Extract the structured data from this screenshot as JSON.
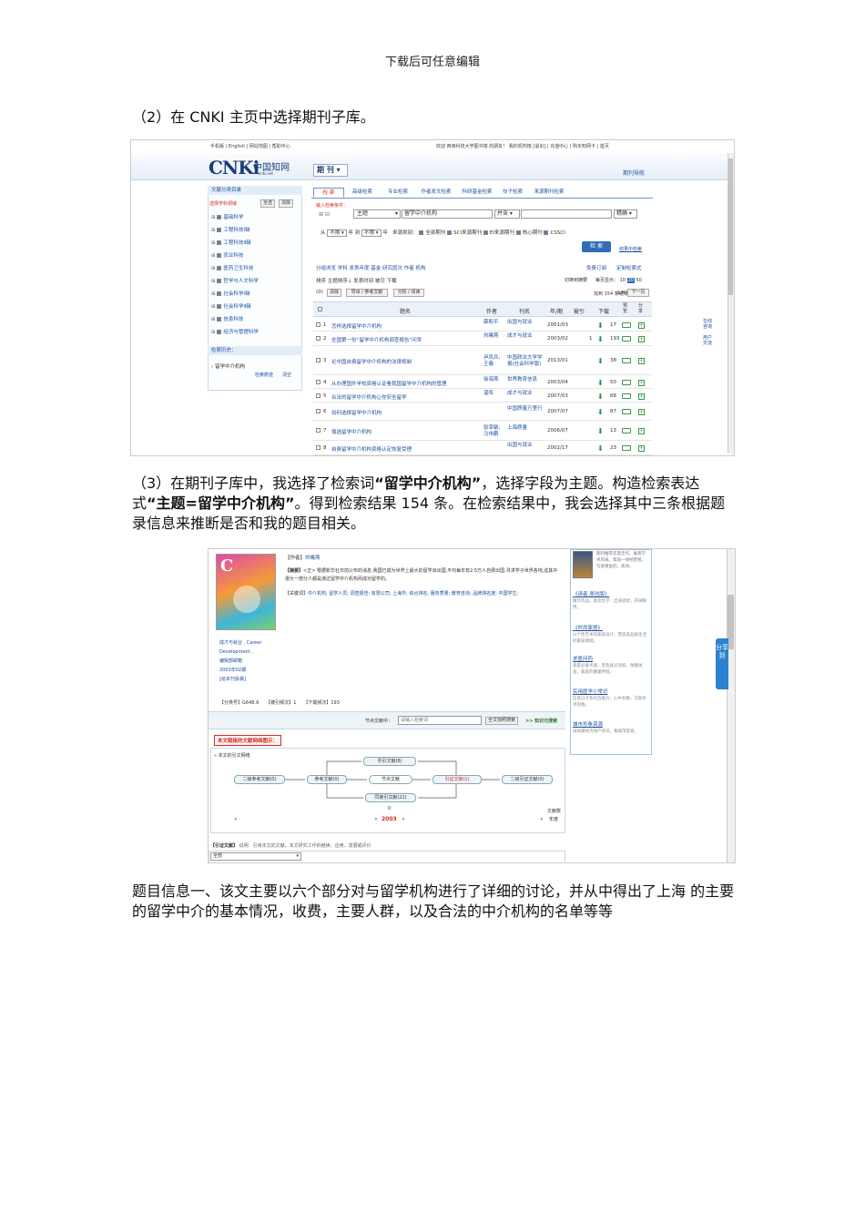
{
  "header": "下载后可任意编辑",
  "para1": "（2）在 CNKI 主页中选择期刊子库。",
  "para2_parts": [
    "（3）在期刊子库中，我选择了检索词",
    "“留学中介机构”",
    "，选择字段为主题。构造检索表达式",
    "“主题=留学中介机构”",
    "。得到检索结果 154 条。在检索结果中，我会选择其中三条根据题录信息来推断是否和我的题目相关。"
  ],
  "para3": "题目信息一、该文主要以六个部分对与留学机构进行了详细的讨论，并从中得出了上海 的主要的留学中介的基本情况，收费，主要人群，以及合法的中介机构的名单等等",
  "cnki": {
    "toplinks": [
      "手机版",
      "English",
      "网站地图",
      "帮助中心"
    ],
    "topright": "欢迎  西南科技大学图书馆 的朋友！ 我的机构馆 [退出]  |  充值中心  |  购买知网卡  |  首页",
    "logo": "CNKi",
    "logo_cn": "中国知网",
    "logo_sub": "cnki.net",
    "db_select": "期 刊",
    "nav_link": "期刊导航",
    "side_title": "文献分类目录",
    "side_select": "选择学科领域",
    "side_btn_all": "全选",
    "side_btn_clear": "清除",
    "side_items": [
      "基础科学",
      "工程科技Ⅰ辑",
      "工程科技Ⅱ辑",
      "农业科技",
      "医药卫生科技",
      "哲学与人文科学",
      "社会科学Ⅰ辑",
      "社会科学Ⅱ辑",
      "信息科技",
      "经济与管理科学"
    ],
    "history_title": "检索历史：",
    "history_item": "› 留学中介机构",
    "history_more": "检索痕迹",
    "history_clear": "清空",
    "tabs": [
      "检 索",
      "高级检索",
      "专业检索",
      "作者发文检索",
      "科研基金检索",
      "句子检索",
      "来源期刊检索"
    ],
    "cond_label": "输入检索条件：",
    "field": "主题",
    "query": "留学中介机构",
    "combine": "并含",
    "match": "精确",
    "from_label": "从",
    "year_from": "不限",
    "year_to": "不限",
    "source_label": "来源类别：",
    "sources": [
      "全部期刊",
      "SCI来源期刊",
      "EI来源期刊",
      "核心期刊",
      "CSSCI"
    ],
    "search_btn": "检 索",
    "result_search": "结果中检索",
    "group_bar": "分组浏览   学科   发表年度   基金   研究层次   作者   机构",
    "free_sub": "免费订阅",
    "custom": "定制检索式",
    "sort_bar": "排序   主题排序↓   发表时间   被引   下载",
    "switch_label": "切换到摘要",
    "perpage_label": "每页显示：",
    "perpage": [
      "10",
      "20",
      "50"
    ],
    "selected": "(0)",
    "clear_btn": "清除",
    "export_btn": "导出 / 参考文献",
    "analyze_btn": "分析 / 阅读",
    "result_count": "找到 154 条结果",
    "page": "1/8",
    "next": "下一页",
    "cols": [
      "题名",
      "作者",
      "刊名",
      "年/期",
      "被引",
      "下载",
      "预览",
      "分享"
    ],
    "rows": [
      {
        "n": "1",
        "title": "怎样选择留学中介机构",
        "author": "薛和平",
        "journal": "出国与就业",
        "date": "2001/03",
        "cite": "",
        "dl": "17"
      },
      {
        "n": "2",
        "title": "全国第一份“留学中介机构调查报告”问世",
        "author": "刘曦燕",
        "journal": "成才与就业",
        "date": "2003/02",
        "cite": "1",
        "dl": "193"
      },
      {
        "n": "3",
        "title": "论中国自费留学中介机构的法律规制",
        "author": "尹凤兵; 王春",
        "journal": "中国政法大学学报(社会科学版)",
        "date": "2013/01",
        "cite": "",
        "dl": "38"
      },
      {
        "n": "4",
        "title": "从办理国外学校资格认证看我国留学中介机构的管理",
        "author": "徐海燕",
        "journal": "世界教育信息",
        "date": "2003/04",
        "cite": "",
        "dl": "50"
      },
      {
        "n": "5",
        "title": "合法的留学中介机构让你安全留学",
        "author": "温晖",
        "journal": "成才与就业",
        "date": "2007/03",
        "cite": "",
        "dl": "68"
      },
      {
        "n": "6",
        "title": "如何选择留学中介机构",
        "author": "",
        "journal": "中国质量万里行",
        "date": "2007/07",
        "cite": "",
        "dl": "87"
      },
      {
        "n": "7",
        "title": "慎选留学中介机构",
        "author": "张宰敏; 马伟鹏",
        "journal": "上海质量",
        "date": "2006/07",
        "cite": "",
        "dl": "13"
      },
      {
        "n": "8",
        "title": "自费留学中介机构资格认定恢复受理",
        "author": "",
        "journal": "出国与就业",
        "date": "2002/17",
        "cite": "",
        "dl": "23"
      }
    ],
    "right_side": [
      "在线咨询",
      "用户交流"
    ]
  },
  "detail": {
    "author_label": "【作者】",
    "author": "刘曦燕",
    "abstract_label": "【摘要】",
    "abstract": "<正> 根据新华社日前公布的消息,我国已成为世界上最大的留学派出国,平均每年有2.5万人自费出国,寻求学子世界各地,这其中很大一部分人都是通过留学中介机构而成功留学的。",
    "kw_label": "【关键词】",
    "keywords": "中介机构; 留学人员; 调查报告; 有限公司; 上海市; 综合排名; 服务质量; 教育咨询; 品牌排名度; 中国学生;",
    "journal_lines": [
      "成才与就业 , Career",
      "Development ,",
      "编辑部邮箱",
      "2003年02期",
      "[给本刊投稿]"
    ],
    "cls_label": "【分类号】",
    "cls": "G648.9",
    "cite_label": "【被引频次】",
    "cite": "1",
    "dl_label": "【下载频次】",
    "dl": "193",
    "node_label": "节点文献中：",
    "node_placeholder": "请输入检索词",
    "node_btn": "全文快照搜索",
    "node_link": ">> 知识元搜索",
    "network_title": "本文链接的文献网络图示：",
    "network_sub": "» 本文的引文网络",
    "boxes": {
      "cocite": "共引文献(8)",
      "second_ref": "二级参考文献(0)",
      "ref": "参考文献(0)",
      "node": "节点文献",
      "citing": "引证文献(1)",
      "second_cite": "二级引证文献(0)",
      "co_cited": "同被引文献(22)"
    },
    "axis_zero": "0",
    "axis_year": "2003",
    "axis_label": "文献数",
    "axis_label2": "年度",
    "cite_lit_label": "【引证文献】",
    "cite_lit_desc": "说明：引用本文的文献。本文研究工作的继续、应用、发展或评价",
    "cite_select": "全部",
    "side_links": [
      {
        "t": "《读者 原创版》",
        "d": "精华作品，富含哲学、启迪思想，开阔眼界。"
      },
      {
        "t": "《时尚家居》",
        "d": "以个性艺术的家居设计，营造高品质生活的家居情调。"
      },
      {
        "t": "求医问药",
        "d": "家庭必备手册，普及就诊须知，保健关爱，家庭的健康伴侣。"
      },
      {
        "t": "实用医学小常识",
        "d": "信息口才及综合能力，心中有数，方能妙手回春。"
      },
      {
        "t": "城市形象资源",
        "d": "再将最经济地产资讯，看城市容易。"
      }
    ],
    "side_top": "期刊推荐年度佳作，展现学术风采。帮助一线经营者，写进黄金的，高效。",
    "share_tab": "分享到"
  }
}
